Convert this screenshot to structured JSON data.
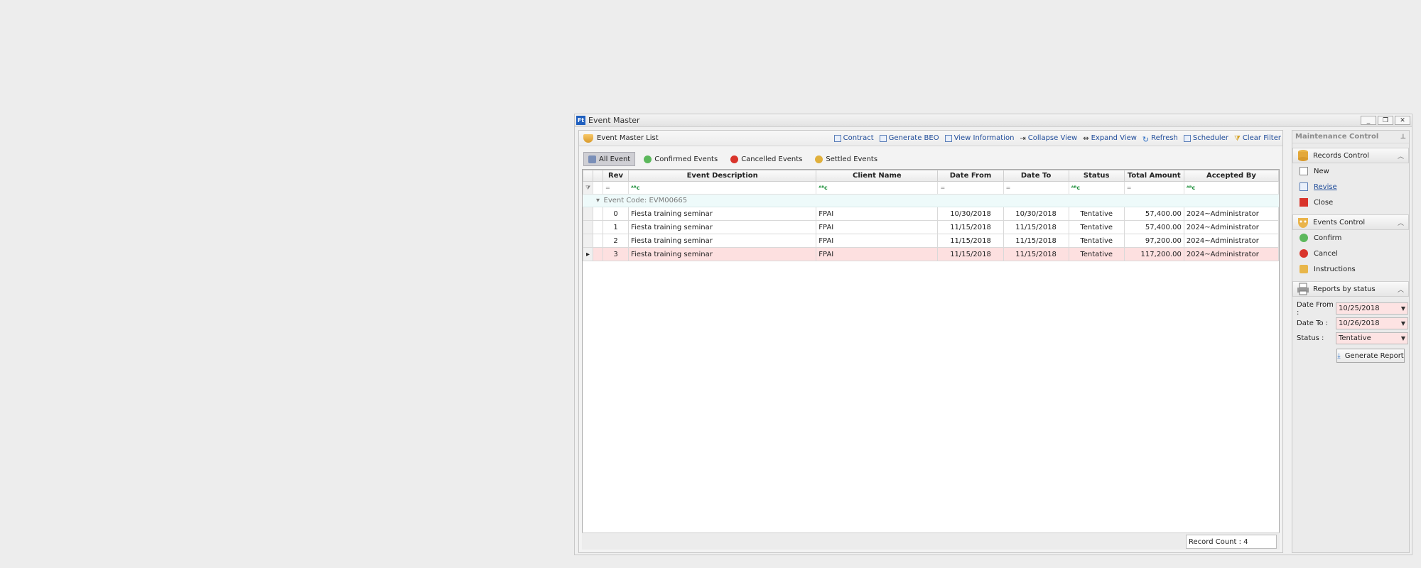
{
  "window": {
    "title": "Event Master",
    "app_icon": "Ft",
    "minimize": "_",
    "restore": "❐",
    "close": "✕"
  },
  "main": {
    "header_title": "Event Master List",
    "toolbar": [
      "Contract",
      "Generate BEO",
      "View Information",
      "Collapse View",
      "Expand View",
      "Refresh",
      "Scheduler",
      "Clear Filter"
    ],
    "tabs": [
      "All Event",
      "Confirmed Events",
      "Cancelled Events",
      "Settled Events"
    ],
    "columns": [
      "Rev",
      "Event Description",
      "Client Name",
      "Date From",
      "Date To",
      "Status",
      "Total Amount",
      "Accepted By"
    ],
    "filter_eq": "=",
    "filter_txt": "ᴬᴮc",
    "group_label": "Event Code: EVM00665",
    "rows": [
      {
        "rev": "0",
        "desc": "Fiesta training seminar",
        "client": "FPAI",
        "from": "10/30/2018",
        "to": "10/30/2018",
        "status": "Tentative",
        "amount": "57,400.00",
        "by": "2024~Administrator"
      },
      {
        "rev": "1",
        "desc": "Fiesta training seminar",
        "client": "FPAI",
        "from": "11/15/2018",
        "to": "11/15/2018",
        "status": "Tentative",
        "amount": "57,400.00",
        "by": "2024~Administrator"
      },
      {
        "rev": "2",
        "desc": "Fiesta training seminar",
        "client": "FPAI",
        "from": "11/15/2018",
        "to": "11/15/2018",
        "status": "Tentative",
        "amount": "97,200.00",
        "by": "2024~Administrator"
      },
      {
        "rev": "3",
        "desc": "Fiesta training seminar",
        "client": "FPAI",
        "from": "11/15/2018",
        "to": "11/15/2018",
        "status": "Tentative",
        "amount": "117,200.00",
        "by": "2024~Administrator"
      }
    ],
    "record_count": "Record Count : 4"
  },
  "side": {
    "title": "Maintenance Control",
    "records_control": {
      "title": "Records Control",
      "items": [
        "New",
        "Revise",
        "Close"
      ]
    },
    "events_control": {
      "title": "Events Control",
      "items": [
        "Confirm",
        "Cancel",
        "Instructions"
      ]
    },
    "reports": {
      "title": "Reports by status",
      "date_from_label": "Date From :",
      "date_from": "10/25/2018",
      "date_to_label": "Date To :",
      "date_to": "10/26/2018",
      "status_label": "Status :",
      "status": "Tentative",
      "generate": "Generate Report"
    }
  }
}
